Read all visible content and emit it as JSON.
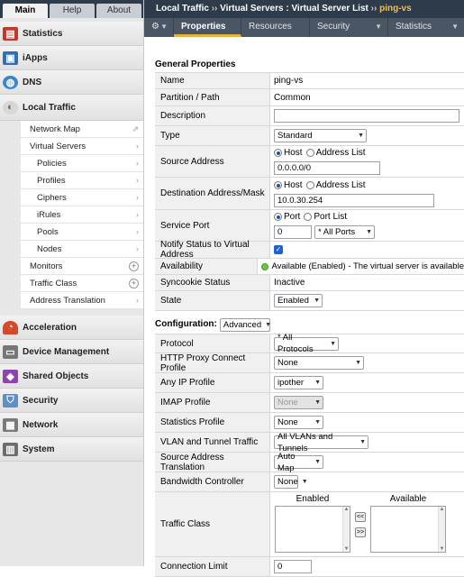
{
  "top_tabs": [
    "Main",
    "Help",
    "About"
  ],
  "breadcrumb": {
    "part1": "Local Traffic",
    "sep": "››",
    "part2": "Virtual Servers : Virtual Server List",
    "current": "ping-vs"
  },
  "menu": {
    "gear": "⚙",
    "tabs": [
      "Properties",
      "Resources",
      "Security",
      "Statistics"
    ]
  },
  "nav": {
    "statistics": "Statistics",
    "iapps": "iApps",
    "dns": "DNS",
    "local_traffic": "Local Traffic",
    "sub": [
      "Network Map",
      "Virtual Servers",
      "Policies",
      "Profiles",
      "Ciphers",
      "iRules",
      "Pools",
      "Nodes",
      "Monitors",
      "Traffic Class",
      "Address Translation"
    ],
    "acceleration": "Acceleration",
    "device_management": "Device Management",
    "shared_objects": "Shared Objects",
    "security": "Security",
    "network": "Network",
    "system": "System"
  },
  "general": {
    "header": "General Properties",
    "name_label": "Name",
    "name": "ping-vs",
    "partition_label": "Partition / Path",
    "partition": "Common",
    "description_label": "Description",
    "description": "",
    "type_label": "Type",
    "type": "Standard",
    "source_label": "Source Address",
    "host": "Host",
    "address_list": "Address List",
    "source": "0.0.0.0/0",
    "dest_label": "Destination Address/Mask",
    "dest": "10.0.30.254",
    "port_label": "Service Port",
    "port": "Port",
    "port_list": "Port List",
    "port_value": "0",
    "port_select": "* All Ports",
    "notify_label": "Notify Status to Virtual Address",
    "availability_label": "Availability",
    "availability": "Available (Enabled) - The virtual server is available",
    "syncookie_label": "Syncookie Status",
    "syncookie": "Inactive",
    "state_label": "State",
    "state": "Enabled"
  },
  "config": {
    "header": "Configuration:",
    "mode": "Advanced",
    "protocol_label": "Protocol",
    "protocol": "* All Protocols",
    "http_proxy_label": "HTTP Proxy Connect Profile",
    "http_proxy": "None",
    "anyip_label": "Any IP Profile",
    "anyip": "ipother",
    "imap_label": "IMAP Profile",
    "imap": "None",
    "stats_label": "Statistics Profile",
    "stats": "None",
    "vlan_label": "VLAN and Tunnel Traffic",
    "vlan": "All VLANs and Tunnels",
    "snat_label": "Source Address Translation",
    "snat": "Auto Map",
    "bw_label": "Bandwidth Controller",
    "bw": "None",
    "traffic_class_label": "Traffic Class",
    "enabled": "Enabled",
    "available": "Available",
    "move_left": "<<",
    "move_right": ">>",
    "conn_limit_label": "Connection Limit",
    "conn_limit": "0"
  }
}
